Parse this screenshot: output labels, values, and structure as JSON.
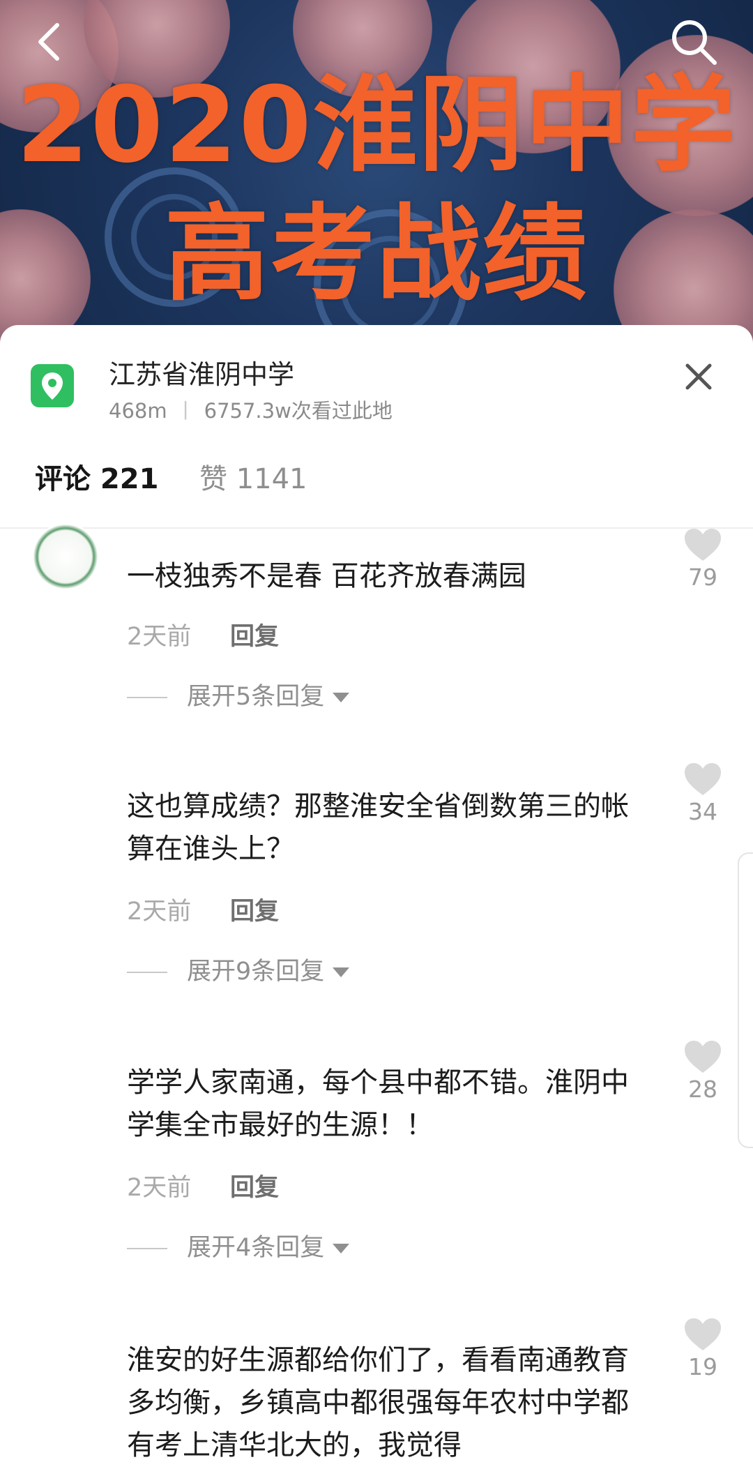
{
  "hero": {
    "line1": "2020淮阴中学",
    "line2": "高考战绩"
  },
  "location": {
    "name": "江苏省淮阴中学",
    "distance": "468m",
    "separator": "丨",
    "views": "6757.3w次看过此地"
  },
  "tabs": {
    "comments": "评论 221",
    "likes": "赞 1141"
  },
  "comments": [
    {
      "author": "",
      "text": "一枝独秀不是春 百花齐放春满园",
      "time": "2天前",
      "reply": "回复",
      "expand": "展开5条回复",
      "likes": "79"
    },
    {
      "author": "",
      "text": "这也算成绩？那整淮安全省倒数第三的帐算在谁头上？",
      "time": "2天前",
      "reply": "回复",
      "expand": "展开9条回复",
      "likes": "34"
    },
    {
      "author": "",
      "text": "学学人家南通，每个县中都不错。淮阴中学集全市最好的生源！！",
      "time": "2天前",
      "reply": "回复",
      "expand": "展开4条回复",
      "likes": "28"
    },
    {
      "author": "",
      "text": "淮安的好生源都给你们了，看看南通教育多均衡，乡镇高中都很强每年农村中学都有考上清华北大的，我觉得",
      "likes": "19"
    }
  ],
  "colors": {
    "hero_text": "#f2622a",
    "location_pin": "#2fbf61",
    "heart": "#d9d9d9"
  },
  "icons": [
    "back-icon",
    "search-icon",
    "location-pin-icon",
    "close-icon",
    "heart-icon",
    "chevron-down-icon"
  ]
}
